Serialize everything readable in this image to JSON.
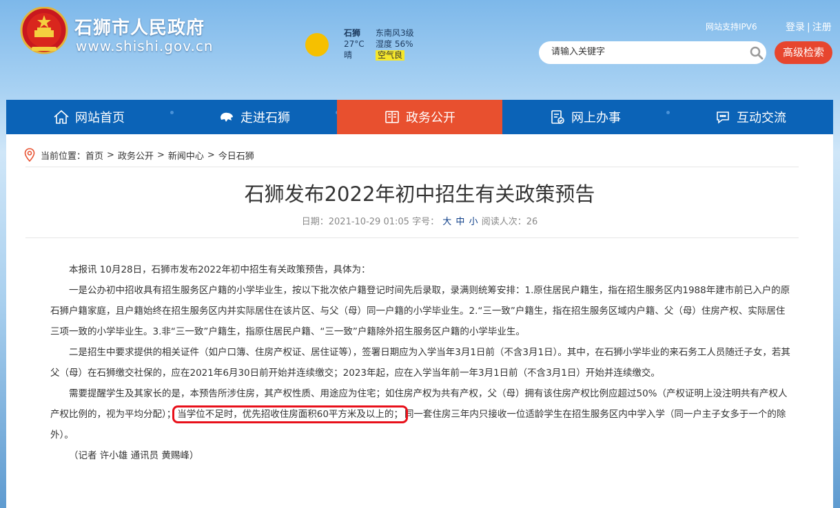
{
  "header": {
    "site_title": "石狮市人民政府",
    "site_url": "www.shishi.gov.cn",
    "ipv6": "网站支持IPV6",
    "login": "登录",
    "register": "注册",
    "login_sep": "|"
  },
  "weather": {
    "city": "石狮",
    "temp": "27°C",
    "condition": "晴",
    "wind": "东南风3级",
    "humidity": "湿度 56%",
    "air": "空气良"
  },
  "search": {
    "placeholder": "请输入关键字",
    "advanced_label": "高级检索"
  },
  "nav": {
    "items": [
      {
        "label": "网站首页",
        "icon": "home-icon"
      },
      {
        "label": "走进石狮",
        "icon": "lion-icon"
      },
      {
        "label": "政务公开",
        "icon": "book-icon",
        "active": true
      },
      {
        "label": "网上办事",
        "icon": "service-doc-icon"
      },
      {
        "label": "互动交流",
        "icon": "chat-icon"
      }
    ]
  },
  "breadcrumb": {
    "prefix": "当前位置：",
    "items": [
      "首页",
      "政务公开",
      "新闻中心",
      "今日石狮"
    ],
    "sep": ">"
  },
  "article": {
    "title": "石狮发布2022年初中招生有关政策预告",
    "date_label": "日期：",
    "date": "2021-10-29 01:05",
    "font_label": "字号：",
    "size_large": "大",
    "size_medium": "中",
    "size_small": "小",
    "views_label": "阅读人次：",
    "views": "26",
    "p1": "本报讯 10月28日，石狮市发布2022年初中招生有关政策预告，具体为：",
    "p2": "一是公办初中招收具有招生服务区户籍的小学毕业生，按以下批次依户籍登记时间先后录取，录满则统筹安排：1.原住居民户籍生，指在招生服务区内1988年建市前已入户的原石狮户籍家庭，且户籍始终在招生服务区内并实际居住在该片区、与父（母）同一户籍的小学毕业生。2.“三一致”户籍生，指在招生服务区域内户籍、父（母）住房产权、实际居住三项一致的小学毕业生。3.非“三一致”户籍生，指原住居民户籍、“三一致”户籍除外招生服务区户籍的小学毕业生。",
    "p3": "二是招生中要求提供的相关证件（如户口簿、住房产权证、居住证等），签署日期应为入学当年3月1日前（不含3月1日）。其中，在石狮小学毕业的来石务工人员随迁子女，若其父（母）在石狮缴交社保的，应在2021年6月30日前开始并连续缴交；2023年起，应在入学当年前一年3月1日前（不含3月1日）开始并连续缴交。",
    "p4_a": "需要提醒学生及其家长的是，本预告所涉住房，其产权性质、用途应为住宅；如住房产权为共有产权，父（母）拥有该住房产权比例应超过50%（产权证明上没注明共有产权人产权比例的，视为平均分配）；",
    "p4_highlight": "当学位不足时，优先招收住房面积60平方米及以上的；",
    "p4_b": "同一套住房三年内只接收一位适龄学生在招生服务区内中学入学（同一户主子女多于一个的除外）。",
    "byline": "（记者 许小雄 通讯员 黄赐峰）"
  }
}
